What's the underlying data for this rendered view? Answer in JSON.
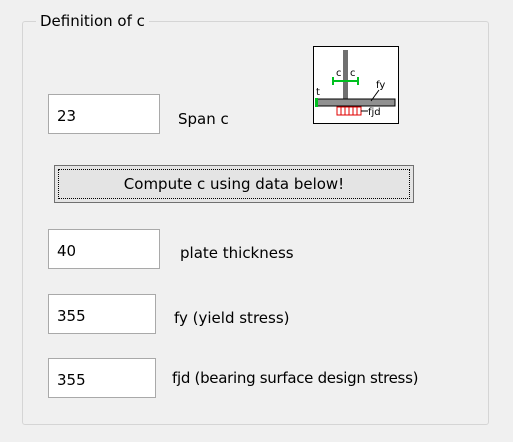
{
  "group": {
    "title": "Definition of c"
  },
  "span": {
    "value": "23",
    "label": "Span c"
  },
  "compute_button": {
    "label": "Compute c using data below!"
  },
  "plate": {
    "value": "40",
    "label": "plate thickness"
  },
  "fy": {
    "value": "355",
    "label": "fy (yield stress)"
  },
  "fjd": {
    "value": "355",
    "label": "fjd (bearing surface design stress)"
  },
  "diagram": {
    "icon": "base-plate-diagram-icon",
    "labels": {
      "c1": "c",
      "c2": "c",
      "t": "t",
      "fy": "fy",
      "fjd": "fjd"
    },
    "colors": {
      "c_dimension": "#00c020",
      "bearing_stress": "#e00000",
      "plate": "#808080"
    }
  }
}
